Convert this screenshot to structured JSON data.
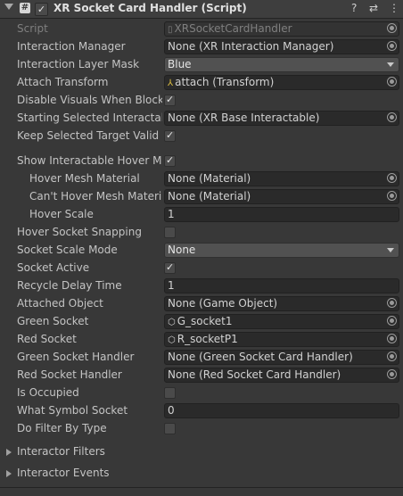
{
  "header": {
    "title": "XR Socket Card Handler (Script)",
    "script_icon": "#",
    "enabled_check": "✓",
    "icons": {
      "help": "?",
      "preset": "⇄",
      "menu": "⋮"
    }
  },
  "rows": {
    "script": {
      "label": "Script",
      "value": "XRSocketCardHandler"
    },
    "interaction_manager": {
      "label": "Interaction Manager",
      "value": "None (XR Interaction Manager)"
    },
    "interaction_layer_mask": {
      "label": "Interaction Layer Mask",
      "value": "Blue"
    },
    "attach_transform": {
      "label": "Attach Transform",
      "value": "attach (Transform)"
    },
    "disable_visuals": {
      "label": "Disable Visuals When Blocked",
      "checked": "✓"
    },
    "starting_selected": {
      "label": "Starting Selected Interactable",
      "value": "None (XR Base Interactable)"
    },
    "keep_selected": {
      "label": "Keep Selected Target Valid",
      "checked": "✓"
    },
    "show_hover_mesh": {
      "label": "Show Interactable Hover Meshes",
      "checked": "✓"
    },
    "hover_mesh_material": {
      "label": "Hover Mesh Material",
      "value": "None (Material)"
    },
    "cant_hover_mesh_material": {
      "label": "Can't Hover Mesh Material",
      "value": "None (Material)"
    },
    "hover_scale": {
      "label": "Hover Scale",
      "value": "1"
    },
    "hover_socket_snapping": {
      "label": "Hover Socket Snapping",
      "checked": ""
    },
    "socket_scale_mode": {
      "label": "Socket Scale Mode",
      "value": "None"
    },
    "socket_active": {
      "label": "Socket Active",
      "checked": "✓"
    },
    "recycle_delay_time": {
      "label": "Recycle Delay Time",
      "value": "1"
    },
    "attached_object": {
      "label": "Attached Object",
      "value": "None (Game Object)"
    },
    "green_socket": {
      "label": "Green Socket",
      "value": "G_socket1"
    },
    "red_socket": {
      "label": "Red Socket",
      "value": "R_socketP1"
    },
    "green_socket_handler": {
      "label": "Green Socket Handler",
      "value": "None (Green Socket Card Handler)"
    },
    "red_socket_handler": {
      "label": "Red Socket Handler",
      "value": "None (Red Socket Card Handler)"
    },
    "is_occupied": {
      "label": "Is Occupied",
      "checked": ""
    },
    "what_symbol_socket": {
      "label": "What Symbol Socket",
      "value": "0"
    },
    "do_filter_by_type": {
      "label": "Do Filter By Type",
      "checked": ""
    }
  },
  "foldouts": {
    "interactor_filters": "Interactor Filters",
    "interactor_events": "Interactor Events"
  }
}
